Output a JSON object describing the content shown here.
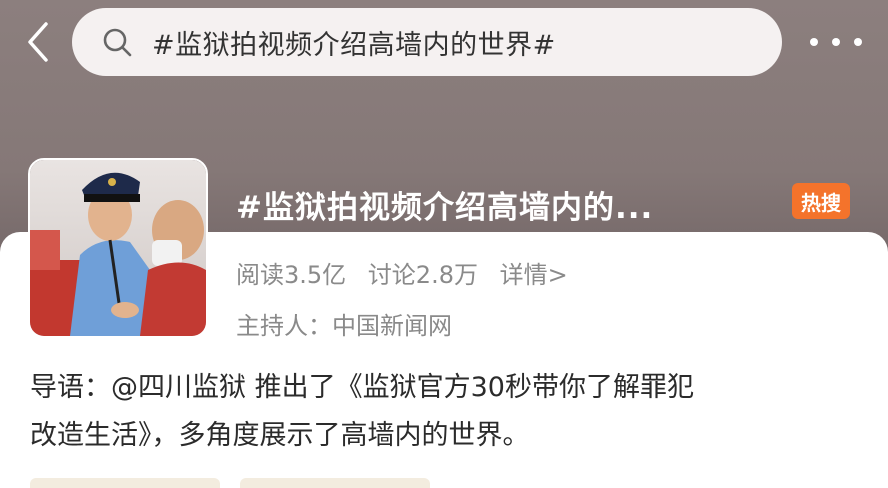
{
  "search": {
    "query": "#监狱拍视频介绍高墙内的世界#"
  },
  "topic": {
    "title": "#监狱拍视频介绍高墙内的...",
    "badge": "热搜",
    "reads": "阅读3.5亿",
    "discussions": "讨论2.8万",
    "details_link": "详情>",
    "host": "主持人：中国新闻网"
  },
  "intro": {
    "line1": "导语：@四川监狱 推出了《监狱官方30秒带你了解罪犯",
    "line2": "改造生活》，多角度展示了高墙内的世界。"
  },
  "colors": {
    "badge": "#f4732b",
    "card": "#ffffff",
    "muted_text": "#8a8a8a"
  },
  "icons": {
    "back": "back-arrow-icon",
    "search": "search-icon",
    "more": "more-dots-icon",
    "thumbnail": "topic-thumbnail-image"
  }
}
